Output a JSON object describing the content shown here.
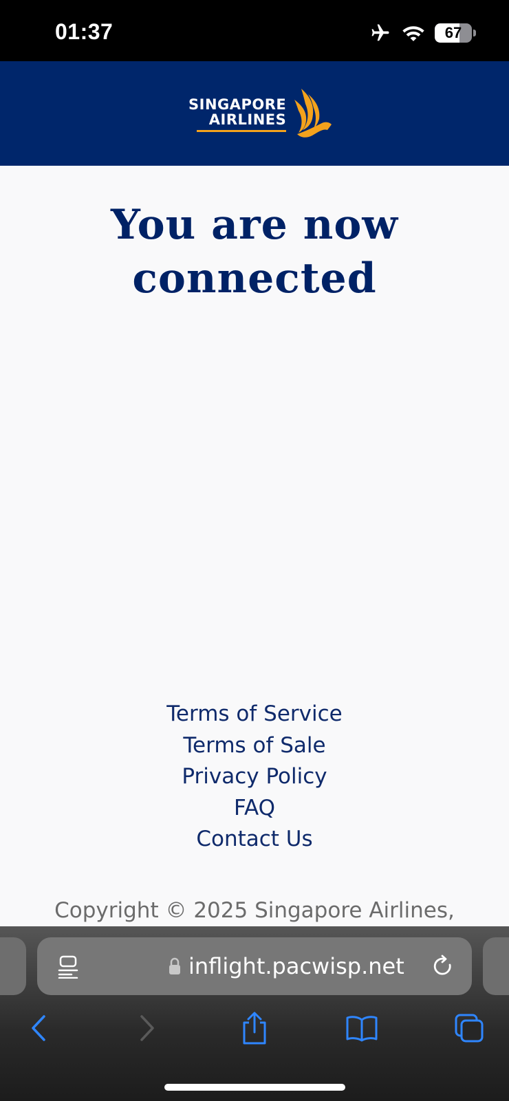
{
  "status_bar": {
    "time": "01:37",
    "battery_level": "67",
    "battery_percent": 67
  },
  "header": {
    "logo_line1": "SINGAPORE",
    "logo_line2": "AIRLINES",
    "logo_colors": {
      "background": "#00266b",
      "accent": "#f4a21c"
    }
  },
  "main": {
    "title_line1": "You are now",
    "title_line2": "connected"
  },
  "footer": {
    "links": [
      {
        "label": "Terms of Service"
      },
      {
        "label": "Terms of Sale"
      },
      {
        "label": "Privacy Policy"
      },
      {
        "label": "FAQ"
      },
      {
        "label": "Contact Us"
      }
    ],
    "copyright": "Copyright © 2025 Singapore Airlines,"
  },
  "browser": {
    "url": "inflight.pacwisp.net",
    "icons": [
      "reader-icon",
      "lock-icon",
      "reload-icon",
      "back-icon",
      "forward-icon",
      "share-icon",
      "bookmarks-icon",
      "tabs-icon"
    ],
    "accent_color": "#2f86ff"
  }
}
